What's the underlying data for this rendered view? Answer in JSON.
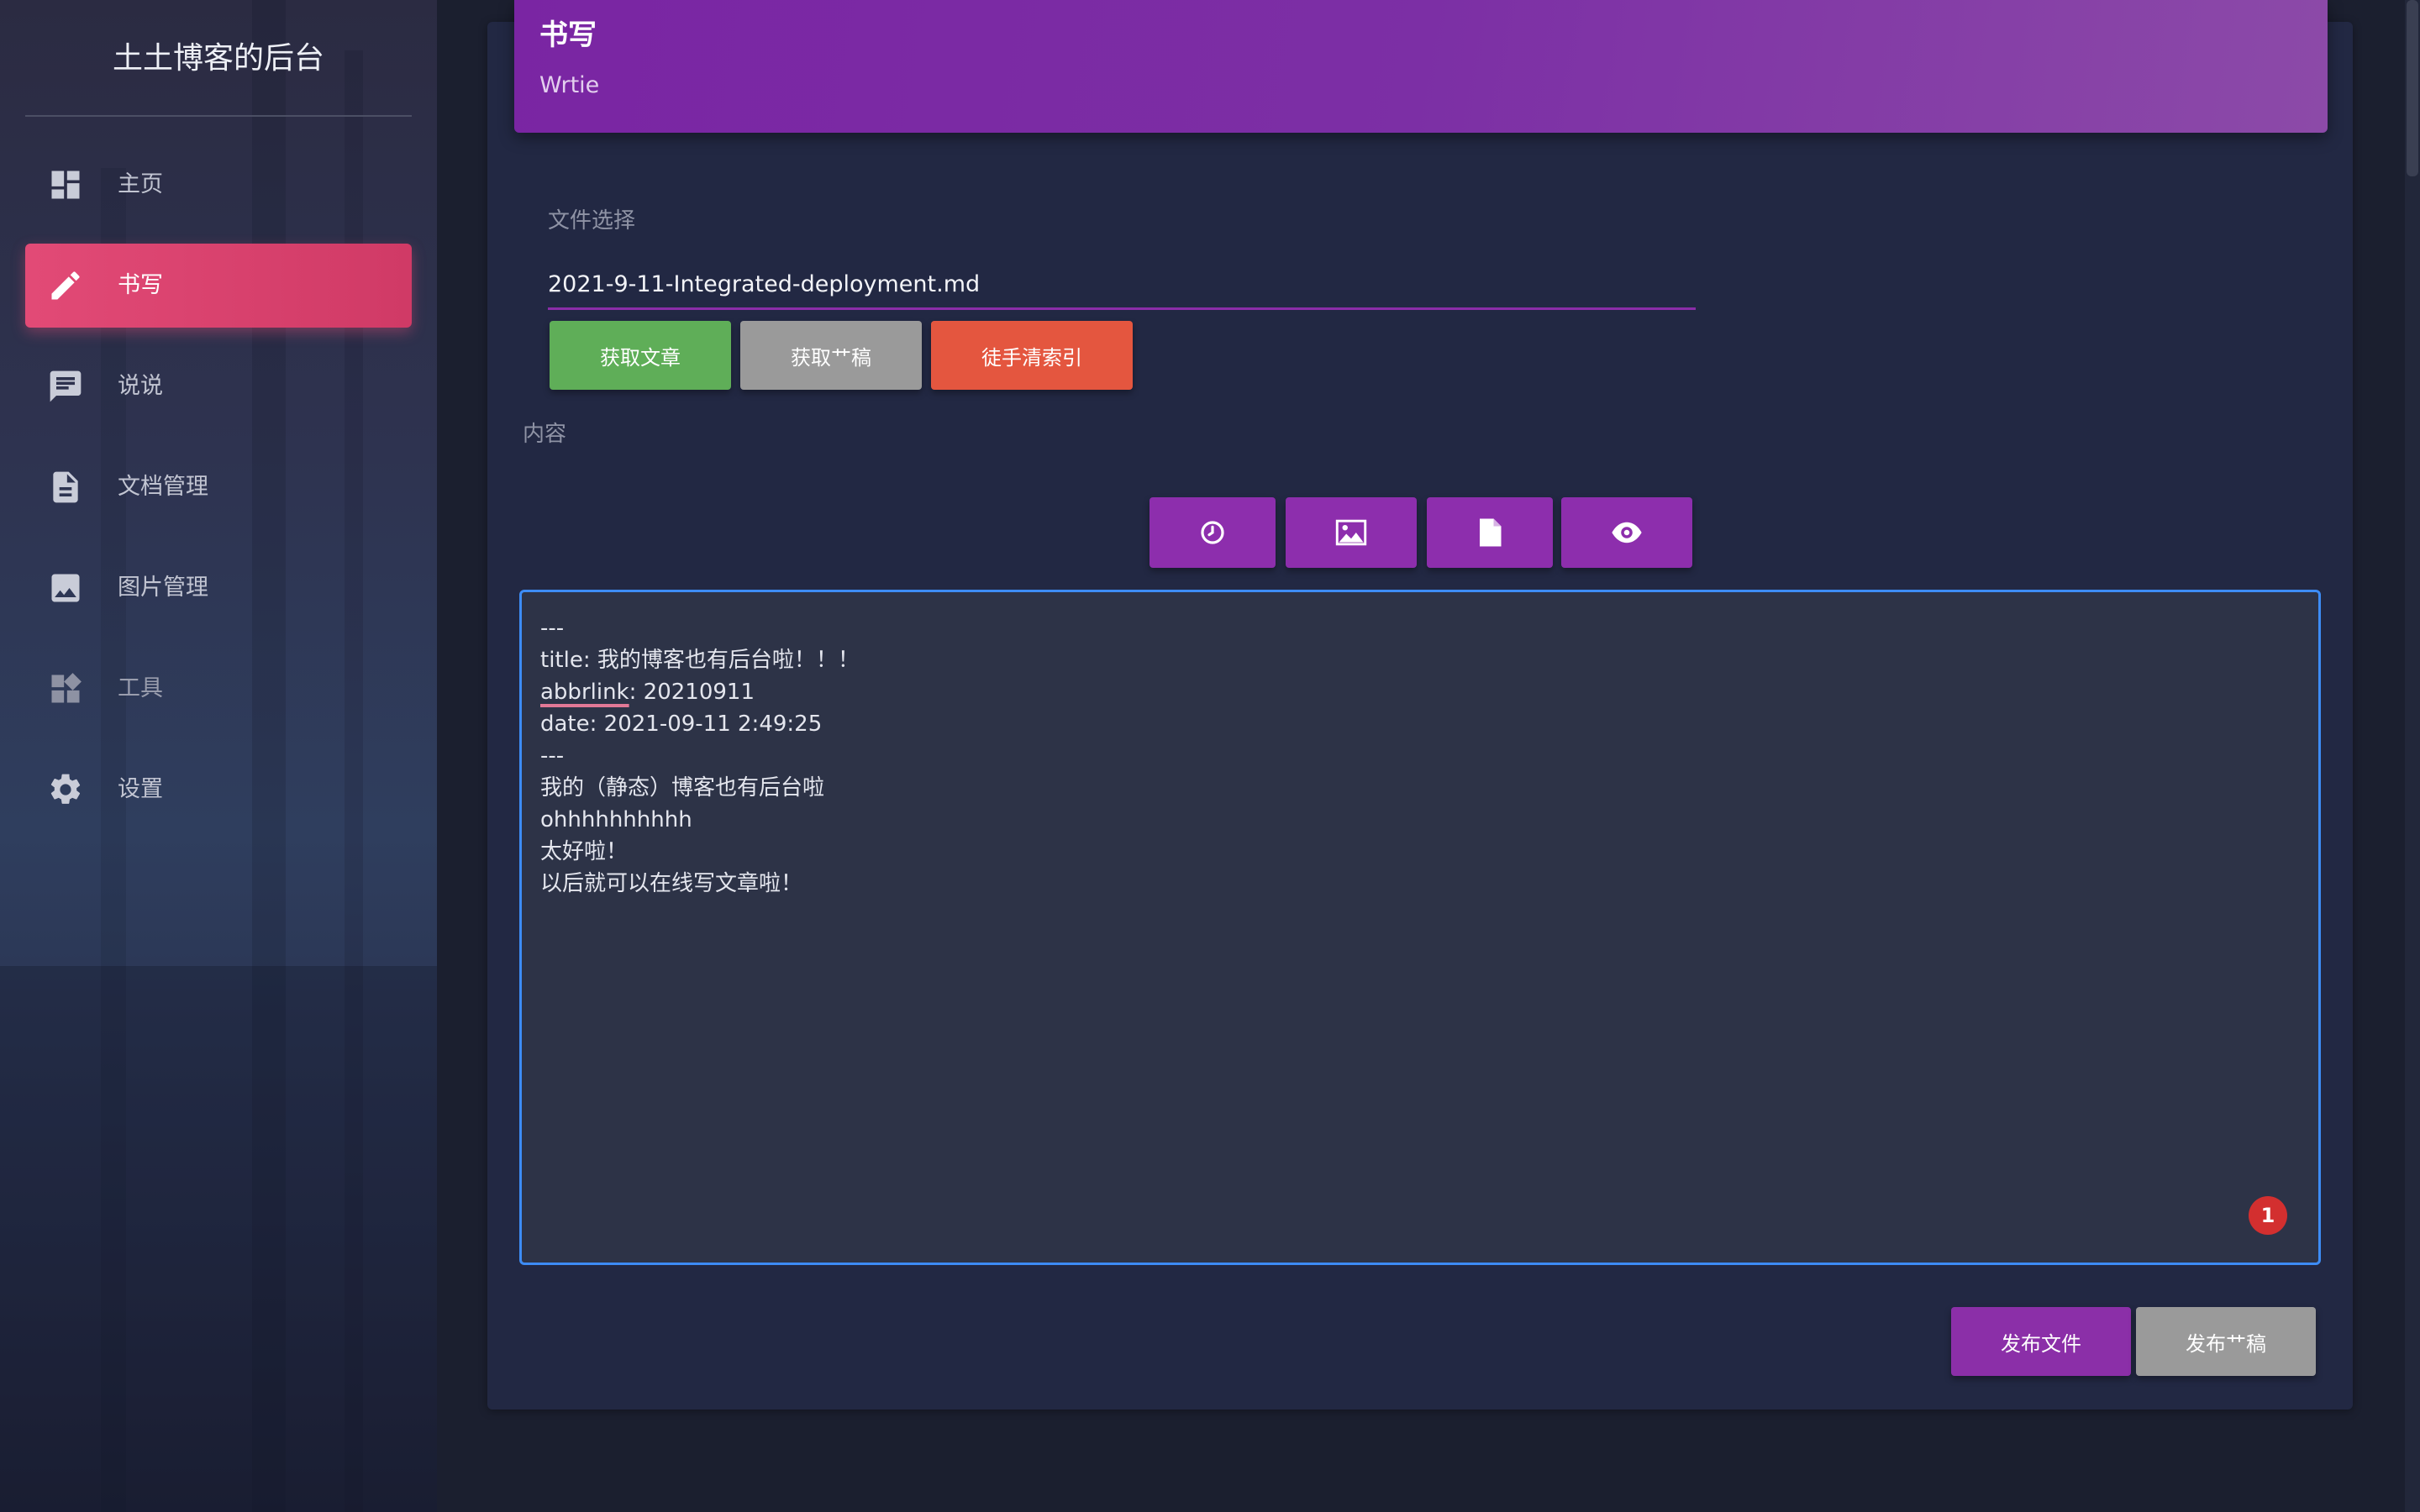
{
  "sidebar": {
    "title": "土土博客的后台",
    "items": [
      {
        "label": "主页",
        "icon": "dashboard-icon"
      },
      {
        "label": "书写",
        "icon": "pencil-icon"
      },
      {
        "label": "说说",
        "icon": "chat-icon"
      },
      {
        "label": "文档管理",
        "icon": "document-icon"
      },
      {
        "label": "图片管理",
        "icon": "image-icon"
      },
      {
        "label": "工具",
        "icon": "widgets-icon"
      },
      {
        "label": "设置",
        "icon": "gear-icon"
      }
    ],
    "active_item": "书写"
  },
  "header": {
    "title": "书写",
    "subtitle": "Wrtie"
  },
  "file_select": {
    "label": "文件选择",
    "value": "2021-9-11-Integrated-deployment.md"
  },
  "actions": {
    "get_article": "获取文章",
    "get_draft": "获取艹稿",
    "manual_clear_index": "徒手清索引"
  },
  "content": {
    "label": "内容",
    "toolbar": [
      "clock-icon",
      "image-icon",
      "file-icon",
      "eye-icon"
    ],
    "lines": [
      "---",
      "title: 我的博客也有后台啦！！！",
      "abbrlink: 20210911",
      "date: 2021-09-11 2:49:25",
      "---",
      "我的（静态）博客也有后台啦",
      "ohhhhhhhhhh",
      "太好啦！",
      "以后就可以在线写文章啦！"
    ],
    "spellcheck_word": "abbrlink",
    "abbrlink_rest": ": 20210911",
    "badge_count": "1"
  },
  "footer": {
    "publish_file": "发布文件",
    "publish_draft": "发布艹稿"
  },
  "colors": {
    "accent_purple": "#8b2fa8",
    "active_pink": "#e24a76",
    "editor_border": "#3d8cf5"
  }
}
